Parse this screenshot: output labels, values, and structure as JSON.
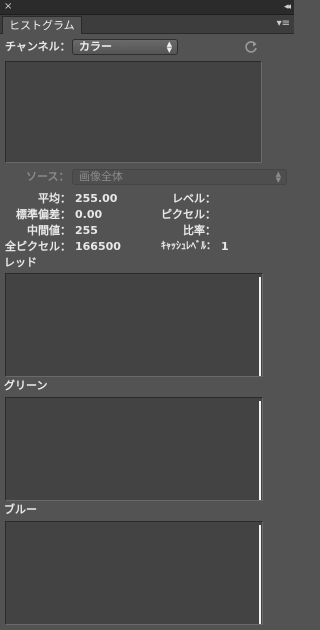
{
  "titlebar": {
    "close_glyph": "×",
    "collapse_glyph": "◂◂"
  },
  "panel": {
    "tab_label": "ヒストグラム",
    "menu_glyph": "▾≡"
  },
  "channel": {
    "label": "チャンネル：",
    "value": "カラー"
  },
  "source": {
    "label": "ソース：",
    "value": "画像全体"
  },
  "stats_left": [
    {
      "label": "平均：",
      "value": "255.00"
    },
    {
      "label": "標準偏差：",
      "value": "0.00"
    },
    {
      "label": "中間値：",
      "value": "255"
    },
    {
      "label": "全ピクセル：",
      "value": "166500"
    }
  ],
  "stats_right": [
    {
      "label": "レベル：",
      "value": ""
    },
    {
      "label": "ピクセル：",
      "value": ""
    },
    {
      "label": "比率：",
      "value": ""
    },
    {
      "label": "ｷｬｯｼｭﾚﾍﾞﾙ：",
      "value": "1"
    }
  ],
  "channels": [
    {
      "label": "レッド"
    },
    {
      "label": "グリーン"
    },
    {
      "label": "ブルー"
    }
  ],
  "colors": {
    "panel_bg": "#535353",
    "histogram_bg": "#434343",
    "spike": "#f4f4f4"
  },
  "icons": {
    "refresh": "refresh-icon",
    "panel_menu": "panel-menu-icon"
  }
}
